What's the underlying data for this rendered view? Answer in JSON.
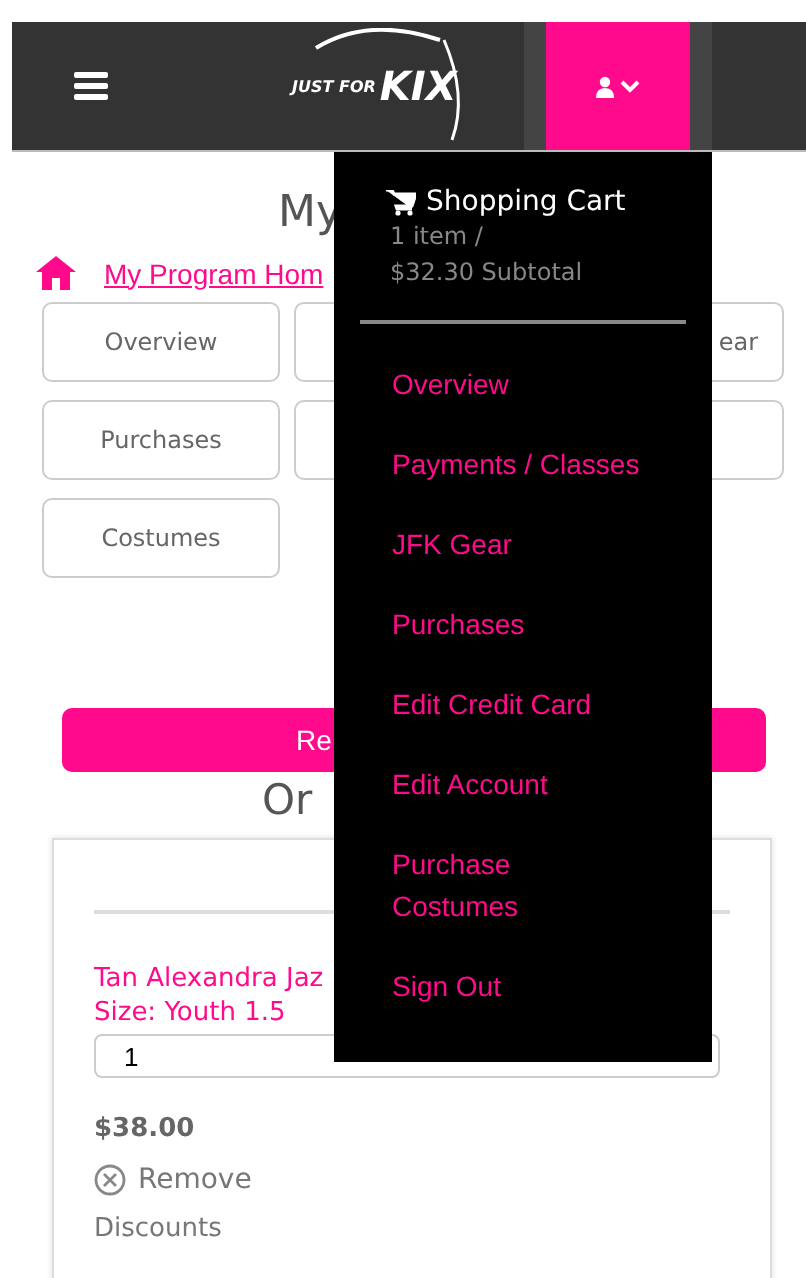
{
  "header": {
    "logo_small": "JUST FOR",
    "logo_big": "KIX",
    "account_menu_open": true
  },
  "page": {
    "title": "My",
    "breadcrumb": "My Program Hom",
    "tiles": [
      {
        "kind": "text",
        "label": "Overview"
      },
      {
        "kind": "covered"
      },
      {
        "kind": "text",
        "label": "ear"
      },
      {
        "kind": "text",
        "label": "Purchases"
      },
      {
        "kind": "covered"
      },
      {
        "kind": "covered"
      },
      {
        "kind": "text",
        "label": "Costumes"
      }
    ],
    "action_button": "Re",
    "section_title": "Or"
  },
  "order": {
    "item_name": "Tan Alexandra Jaz",
    "item_size": "Size: Youth 1.5",
    "quantity": "1",
    "price": "$38.00",
    "remove": "Remove",
    "discounts": "Discounts"
  },
  "menu": {
    "cart_title": "Shopping Cart",
    "cart_count": "1 item /",
    "cart_subtotal": "$32.30 Subtotal",
    "items": [
      "Overview",
      "Payments / Classes",
      "JFK Gear",
      "Purchases",
      "Edit Credit Card",
      "Edit Account",
      "Purchase\nCostumes",
      "Sign Out"
    ]
  }
}
